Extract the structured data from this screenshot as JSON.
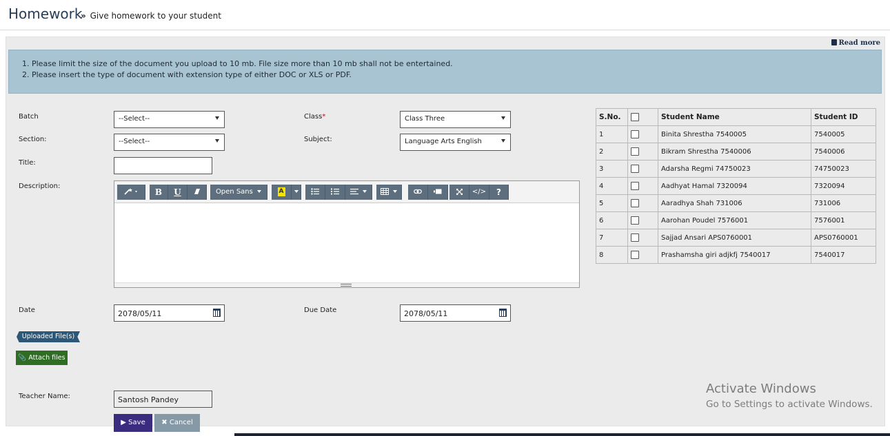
{
  "header": {
    "title": "Homework",
    "subtitle": "Give homework to your student",
    "subtitle_marker": "»"
  },
  "read_more": "Read more",
  "notice": {
    "line1": "1. Please limit the size of the document you upload to 10 mb. File size more than 10 mb shall not be entertained.",
    "line2": "2. Please insert the type of document with extension type of either DOC or XLS or PDF."
  },
  "form": {
    "batch_label": "Batch",
    "batch_value": "--Select--",
    "section_label": "Section:",
    "section_value": "--Select--",
    "class_label": "Class",
    "class_required": "*",
    "class_value": "Class Three",
    "subject_label": "Subject:",
    "subject_value": "Language Arts English",
    "title_label": "Title:",
    "title_value": "",
    "description_label": "Description:",
    "date_label": "Date",
    "date_value": "2078/05/11",
    "due_date_label": "Due Date",
    "due_date_value": "2078/05/11",
    "teacher_label": "Teacher Name:",
    "teacher_value": "Santosh  Pandey"
  },
  "editor_toolbar": {
    "font_name": "Open Sans",
    "highlight_letter": "A",
    "bold": "B",
    "underline": "U",
    "help": "?",
    "code": "</>"
  },
  "buttons": {
    "uploaded_files": "Uploaded File(s)",
    "attach_files": "Attach files",
    "save": "Save",
    "cancel": "Cancel"
  },
  "students_table": {
    "headers": {
      "sno": "S.No.",
      "name": "Student Name",
      "id": "Student ID"
    },
    "rows": [
      {
        "sno": "1",
        "name": "Binita Shrestha 7540005",
        "id": "7540005"
      },
      {
        "sno": "2",
        "name": "Bikram Shrestha 7540006",
        "id": "7540006"
      },
      {
        "sno": "3",
        "name": "Adarsha Regmi 74750023",
        "id": "74750023"
      },
      {
        "sno": "4",
        "name": "Aadhyat Hamal 7320094",
        "id": "7320094"
      },
      {
        "sno": "5",
        "name": "Aaradhya Shah 731006",
        "id": "731006"
      },
      {
        "sno": "6",
        "name": "Aarohan Poudel 7576001",
        "id": "7576001"
      },
      {
        "sno": "7",
        "name": "Sajjad Ansari APS0760001",
        "id": "APS0760001"
      },
      {
        "sno": "8",
        "name": "Prashamsha giri adjkfj 7540017",
        "id": "7540017"
      }
    ]
  },
  "watermark": {
    "line1": "Activate Windows",
    "line2": "Go to Settings to activate Windows."
  },
  "colors": {
    "notice_bg": "#a8c3d1",
    "save_button": "#3b2c7f",
    "attach_button": "#2f6d24",
    "uploaded_badge": "#2d5776",
    "toolbar_button": "#5d6f7e"
  }
}
